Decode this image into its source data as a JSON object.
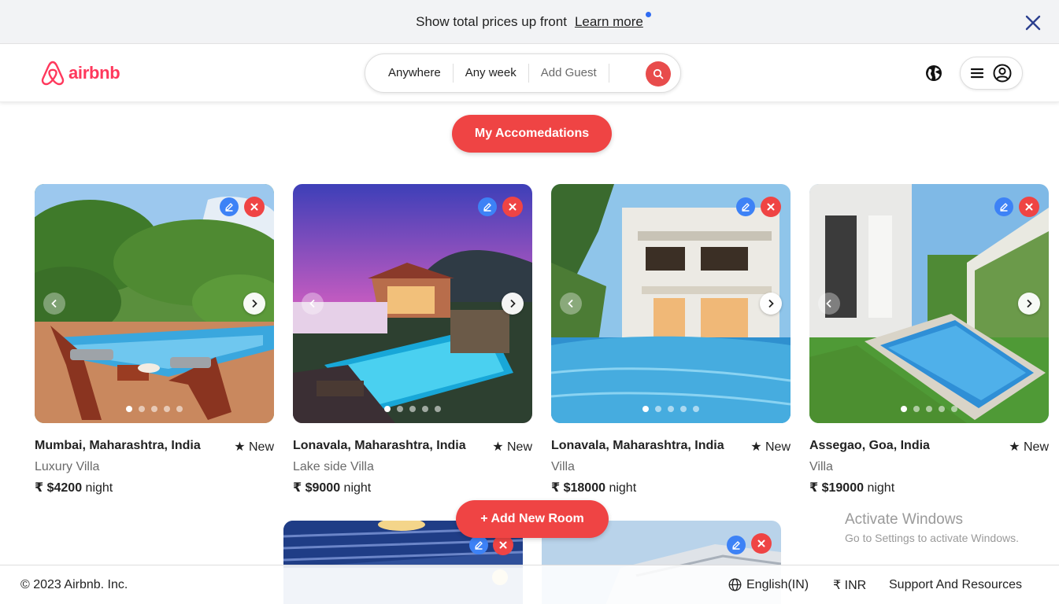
{
  "banner": {
    "text": "Show total prices up front",
    "link": "Learn more"
  },
  "header": {
    "logo_text": "airbnb",
    "search": {
      "where": "Anywhere",
      "when": "Any week",
      "guests": "Add Guest"
    }
  },
  "main": {
    "my_accommodations_label": "My Accomedations",
    "add_room_label": "+ Add New Room"
  },
  "listings": [
    {
      "location": "Mumbai, Maharashtra, India",
      "rating": "★ New",
      "type": "Luxury Villa",
      "currency": "₹",
      "price": "$4200",
      "unit": "night"
    },
    {
      "location": "Lonavala, Maharashtra, India",
      "rating": "★ New",
      "type": "Lake side Villa",
      "currency": "₹",
      "price": "$9000",
      "unit": "night"
    },
    {
      "location": "Lonavala, Maharashtra, India",
      "rating": "★ New",
      "type": "Villa",
      "currency": "₹",
      "price": "$18000",
      "unit": "night"
    },
    {
      "location": "Assegao, Goa, India",
      "rating": "★ New",
      "type": "Villa",
      "currency": "₹",
      "price": "$19000",
      "unit": "night"
    }
  ],
  "watermark": {
    "title": "Activate Windows",
    "subtitle": "Go to Settings to activate Windows."
  },
  "footer": {
    "copyright": "© 2023 Airbnb. Inc.",
    "language": "English(IN)",
    "currency": "₹ INR",
    "support": "Support And Resources"
  },
  "colors": {
    "brand": "#ff385c",
    "primary_button": "#ef4444",
    "edit_button": "#3d82f6"
  }
}
